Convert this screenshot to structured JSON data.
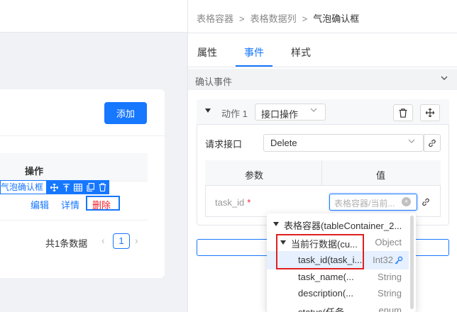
{
  "canvas": {
    "add_button": "添加",
    "table_header_op": "操作",
    "selected_component_label": "气泡确认框",
    "row_actions": {
      "edit": "编辑",
      "detail": "详情",
      "delete": "删除"
    },
    "pagination": {
      "total": "共1条数据",
      "current_page": "1",
      "prev": "‹",
      "next": "›"
    }
  },
  "panel": {
    "breadcrumb": [
      "表格容器",
      "表格数据列",
      "气泡确认框"
    ],
    "breadcrumb_sep": ">",
    "tabs": [
      {
        "label": "属性",
        "active": false
      },
      {
        "label": "事件",
        "active": true
      },
      {
        "label": "样式",
        "active": false
      }
    ],
    "section_title": "确认事件",
    "action": {
      "label": "动作 1",
      "type_value": "接口操作"
    },
    "request": {
      "label": "请求接口",
      "value": "Delete"
    },
    "params_table": {
      "col_param": "参数",
      "col_value": "值",
      "rows": [
        {
          "name": "task_id",
          "required_mark": "*",
          "placeholder": "表格容器/当前..."
        }
      ]
    }
  },
  "dropdown": {
    "items": [
      {
        "label": "表格容器(tableContainer_2...",
        "type": "",
        "level": 0,
        "expanded": true
      },
      {
        "label": "当前行数据(cu...",
        "type": "Object",
        "level": 1,
        "expanded": true
      },
      {
        "label": "task_id(task_i...",
        "type": "Int32",
        "level": 2,
        "highlighted": true
      },
      {
        "label": "task_name(...",
        "type": "String",
        "level": 2
      },
      {
        "label": "description(...",
        "type": "String",
        "level": 2
      },
      {
        "label": "status(任务...",
        "type": "enum",
        "level": 2
      }
    ]
  },
  "colors": {
    "primary": "#1677ff",
    "danger": "#f5222d",
    "annotation_red": "#e02020"
  }
}
